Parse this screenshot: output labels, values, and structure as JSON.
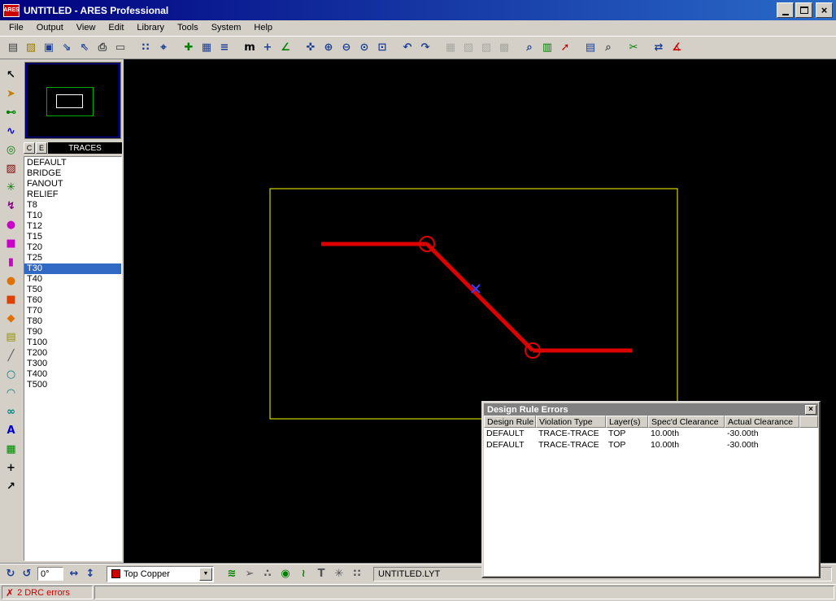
{
  "window": {
    "title": "UNTITLED - ARES Professional",
    "app_badge": "ARES",
    "close_glyph": "×"
  },
  "menu": {
    "items": [
      {
        "name": "menu-file",
        "label": "File"
      },
      {
        "name": "menu-output",
        "label": "Output"
      },
      {
        "name": "menu-view",
        "label": "View"
      },
      {
        "name": "menu-edit",
        "label": "Edit"
      },
      {
        "name": "menu-library",
        "label": "Library"
      },
      {
        "name": "menu-tools",
        "label": "Tools"
      },
      {
        "name": "menu-system",
        "label": "System"
      },
      {
        "name": "menu-help",
        "label": "Help"
      }
    ]
  },
  "toolbar": {
    "icons": [
      {
        "name": "new-layout-icon",
        "glyph": "▤",
        "color": "#404040"
      },
      {
        "name": "open-layout-icon",
        "glyph": "▨",
        "color": "#9a7b00"
      },
      {
        "name": "save-layout-icon",
        "glyph": "▣",
        "color": "#1c3f94"
      },
      {
        "name": "import-section-icon",
        "glyph": "⇘",
        "color": "#1c3f94"
      },
      {
        "name": "export-section-icon",
        "glyph": "⇖",
        "color": "#1c3f94"
      },
      {
        "name": "print-layout-icon",
        "glyph": "⎙",
        "color": "#404040"
      },
      {
        "name": "mark-output-area-icon",
        "glyph": "▭",
        "color": "#404040"
      },
      {
        "sep": true
      },
      {
        "name": "toggle-grid-icon",
        "glyph": "∷",
        "color": "#1c3f94"
      },
      {
        "name": "toggle-origin-icon",
        "glyph": "⌖",
        "color": "#1c3f94"
      },
      {
        "sep": true
      },
      {
        "name": "x-cursor-icon",
        "glyph": "✚",
        "color": "#008000"
      },
      {
        "name": "snap-lock-icon",
        "glyph": "▦",
        "color": "#1c3f94"
      },
      {
        "name": "layers-dialog-icon",
        "glyph": "≡",
        "color": "#1c3f94"
      },
      {
        "sep": true
      },
      {
        "name": "units-toggle-icon",
        "glyph": "m",
        "color": "#000000"
      },
      {
        "name": "origin-marker-icon",
        "glyph": "+",
        "color": "#1c3f94"
      },
      {
        "name": "trace-angle-icon",
        "glyph": "∠",
        "color": "#008000"
      },
      {
        "sep": true
      },
      {
        "name": "pan-icon",
        "glyph": "✜",
        "color": "#1c3f94"
      },
      {
        "name": "zoom-in-icon",
        "glyph": "⊕",
        "color": "#1c3f94"
      },
      {
        "name": "zoom-out-icon",
        "glyph": "⊖",
        "color": "#1c3f94"
      },
      {
        "name": "zoom-all-icon",
        "glyph": "⊙",
        "color": "#1c3f94"
      },
      {
        "name": "zoom-area-icon",
        "glyph": "⊡",
        "color": "#1c3f94"
      },
      {
        "sep": true
      },
      {
        "name": "undo-icon",
        "glyph": "↶",
        "color": "#1c3f94"
      },
      {
        "name": "redo-icon",
        "glyph": "↷",
        "color": "#1c3f94"
      },
      {
        "sep": true
      },
      {
        "name": "block-copy-icon",
        "glyph": "▦",
        "disabled": true
      },
      {
        "name": "block-move-icon",
        "glyph": "▧",
        "disabled": true
      },
      {
        "name": "block-rotate-icon",
        "glyph": "▨",
        "disabled": true
      },
      {
        "name": "block-delete-icon",
        "glyph": "▩",
        "disabled": true
      },
      {
        "sep": true
      },
      {
        "name": "pick-parts-icon",
        "glyph": "⌕",
        "color": "#1c3f94"
      },
      {
        "name": "make-package-icon",
        "glyph": "▥",
        "color": "#008000"
      },
      {
        "name": "decompose-icon",
        "glyph": "➚",
        "color": "#cc0000"
      },
      {
        "sep": true
      },
      {
        "name": "template-colours-icon",
        "glyph": "▤",
        "color": "#1c3f94"
      },
      {
        "name": "search-tag-icon",
        "glyph": "⌕",
        "color": "#555555"
      },
      {
        "sep": true
      },
      {
        "name": "auto-router-icon",
        "glyph": "✂",
        "color": "#008000"
      },
      {
        "sep": true
      },
      {
        "name": "connectivity-check-icon",
        "glyph": "⇄",
        "color": "#1c3f94"
      },
      {
        "name": "design-rule-check-icon",
        "glyph": "∡",
        "color": "#cc0000"
      }
    ]
  },
  "palette": {
    "items": [
      {
        "name": "selection-mode-icon",
        "glyph": "↖",
        "color": "#000000"
      },
      {
        "name": "component-mode-icon",
        "glyph": "➤",
        "color": "#c08000"
      },
      {
        "name": "package-mode-icon",
        "glyph": "⊷",
        "color": "#008000"
      },
      {
        "name": "trace-mode-icon",
        "glyph": "∿",
        "color": "#0000cc"
      },
      {
        "name": "via-mode-icon",
        "glyph": "◎",
        "color": "#008000"
      },
      {
        "name": "zone-mode-icon",
        "glyph": "▨",
        "color": "#800000"
      },
      {
        "name": "ratsnest-mode-icon",
        "glyph": "✳",
        "color": "#008000"
      },
      {
        "name": "connectivity-highlight-icon",
        "glyph": "↯",
        "color": "#800080"
      },
      {
        "name": "round-pad-icon",
        "glyph": "●",
        "color": "#cc00cc"
      },
      {
        "name": "square-pad-icon",
        "glyph": "■",
        "color": "#cc00cc"
      },
      {
        "name": "dil-pad-icon",
        "glyph": "▮",
        "color": "#cc00cc"
      },
      {
        "name": "smt-round-pad-icon",
        "glyph": "●",
        "color": "#e07000"
      },
      {
        "name": "smt-square-pad-icon",
        "glyph": "■",
        "color": "#e04000"
      },
      {
        "name": "smt-poly-pad-icon",
        "glyph": "◆",
        "color": "#e07000"
      },
      {
        "name": "padstack-icon",
        "glyph": "▤",
        "color": "#909000"
      },
      {
        "name": "2d-line-icon",
        "glyph": "╱",
        "color": "#555555"
      },
      {
        "name": "2d-circle-icon",
        "glyph": "○",
        "color": "#008080"
      },
      {
        "name": "2d-arc-icon",
        "glyph": "◠",
        "color": "#008080"
      },
      {
        "name": "2d-path-icon",
        "glyph": "∞",
        "color": "#008080"
      },
      {
        "name": "2d-text-icon",
        "glyph": "A",
        "color": "#0000cc"
      },
      {
        "name": "2d-symbol-icon",
        "glyph": "▦",
        "color": "#008000"
      },
      {
        "name": "marker-mode-icon",
        "glyph": "+",
        "color": "#000000"
      },
      {
        "name": "dimension-mode-icon",
        "glyph": "↗",
        "color": "#000000"
      }
    ]
  },
  "sidebar": {
    "selector_c": "C",
    "selector_e": "E",
    "panel_title": "TRACES",
    "items": [
      "DEFAULT",
      "BRIDGE",
      "FANOUT",
      "RELIEF",
      "T8",
      "T10",
      "T12",
      "T15",
      "T20",
      "T25",
      "T30",
      "T40",
      "T50",
      "T60",
      "T70",
      "T80",
      "T90",
      "T100",
      "T200",
      "T300",
      "T400",
      "T500"
    ],
    "selected": "T30",
    "overview": {
      "frame_color": "#0000b4",
      "board_color": "#00a800",
      "view_color": "#ffffff"
    }
  },
  "canvas": {
    "board_color": "#fcfc00",
    "trace_color": "#dc0000",
    "marker_color": "#3c3cff"
  },
  "drc_window": {
    "title": "Design Rule Errors",
    "close_glyph": "×",
    "columns": [
      "Design Rule",
      "Violation Type",
      "Layer(s)",
      "Spec'd Clearance",
      "Actual Clearance"
    ],
    "rows": [
      [
        "DEFAULT",
        "TRACE-TRACE",
        "TOP",
        "10.00th",
        "-30.00th"
      ],
      [
        "DEFAULT",
        "TRACE-TRACE",
        "TOP",
        "10.00th",
        "-30.00th"
      ]
    ]
  },
  "bottom_bar": {
    "rotate_icons": [
      {
        "name": "rotate-clockwise-icon",
        "glyph": "↻",
        "color": "#1c3f94"
      },
      {
        "name": "rotate-anticlockwise-icon",
        "glyph": "↺",
        "color": "#1c3f94"
      }
    ],
    "angle": "0°",
    "flip_icons": [
      {
        "name": "flip-horizontal-icon",
        "glyph": "↔",
        "color": "#1c3f94"
      },
      {
        "name": "flip-vertical-icon",
        "glyph": "↕",
        "color": "#1c3f94"
      }
    ],
    "layer_label": "Top Copper",
    "layer_color": "#cc0000",
    "dropdown_glyph": "▼",
    "filter_icons": [
      {
        "name": "filter-traces-icon",
        "glyph": "≋",
        "color": "#008000"
      },
      {
        "name": "filter-ratsnest-icon",
        "glyph": "➢",
        "color": "#555555"
      },
      {
        "name": "filter-pads-icon",
        "glyph": "∴",
        "color": "#555555"
      },
      {
        "name": "filter-vias-icon",
        "glyph": "◉",
        "color": "#008000"
      },
      {
        "name": "filter-zones-icon",
        "glyph": "≀",
        "color": "#008000"
      },
      {
        "name": "filter-text-icon",
        "glyph": "T",
        "color": "#555555"
      },
      {
        "name": "filter-graphics-icon",
        "glyph": "✳",
        "color": "#555555"
      },
      {
        "name": "filter-markers-icon",
        "glyph": "∷",
        "color": "#555555"
      }
    ],
    "filename": "UNTITLED.LYT"
  },
  "status_bar": {
    "icon": "✗",
    "message": "2 DRC errors",
    "color": "#cc0000"
  }
}
